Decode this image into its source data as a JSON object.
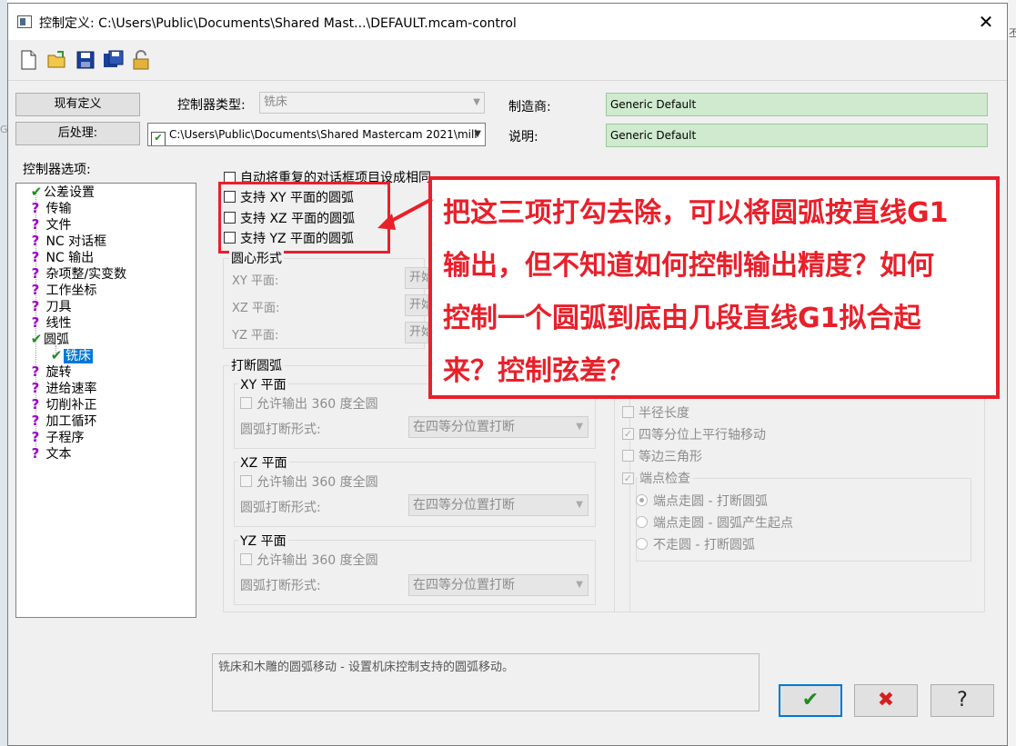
{
  "window": {
    "title": "控制定义: C:\\Users\\Public\\Documents\\Shared Mast...\\DEFAULT.mcam-control",
    "close": "✕"
  },
  "toolbar": {
    "icons": [
      "new-file-icon",
      "open-folder-icon",
      "save-icon",
      "save-as-icon",
      "lock-icon"
    ]
  },
  "buttons": {
    "current_def": "现有定义",
    "post": "后处理:"
  },
  "controller_type": {
    "label": "控制器类型:",
    "value": "铣床"
  },
  "post_path": "C:\\Users\\Public\\Documents\\Shared Mastercam 2021\\mill",
  "manufacturer": {
    "label": "制造商:",
    "value": "Generic Default"
  },
  "description": {
    "label": "说明:",
    "value": "Generic Default"
  },
  "tree": {
    "title": "控制器选项:",
    "items": [
      "公差设置",
      "传输",
      "文件",
      "NC 对话框",
      "NC 输出",
      "杂项整/实变数",
      "工作坐标",
      "刀具",
      "线性",
      "圆弧",
      "铣床",
      "旋转",
      "进给速率",
      "切削补正",
      "加工循环",
      "子程序",
      "文本"
    ]
  },
  "options": {
    "auto_set": "自动将重复的对话框项目设成相同",
    "support_xy": "支持 XY 平面的圆弧",
    "support_xz": "支持 XZ 平面的圆弧",
    "support_yz": "支持 YZ 平面的圆弧"
  },
  "center_form": {
    "title": "圆心形式",
    "rows": [
      {
        "label": "XY 平面:",
        "value": "开始"
      },
      {
        "label": "XZ 平面:",
        "value": "开始"
      },
      {
        "label": "YZ 平面:",
        "value": "开始"
      }
    ]
  },
  "break_arc": {
    "title": "打断圆弧",
    "planes": [
      {
        "title": "XY 平面",
        "allow": "允许输出 360 度全圆",
        "form_label": "圆弧打断形式:",
        "form_value": "在四等分位置打断"
      },
      {
        "title": "XZ 平面",
        "allow": "允许输出 360 度全圆",
        "form_label": "圆弧打断形式:",
        "form_value": "在四等分位置打断"
      },
      {
        "title": "YZ 平面",
        "allow": "允许输出 360 度全圆",
        "form_label": "圆弧打断形式:",
        "form_value": "在四等分位置打断"
      }
    ]
  },
  "right_panel": {
    "radius_length": "半径长度",
    "quadrant_parallel": "四等分位上平行轴移动",
    "equilateral": "等边三角形",
    "endpoint_check": "端点检查",
    "radios": [
      "端点走圆 - 打断圆弧",
      "端点走圆 - 圆弧产生起点",
      "不走圆 - 打断圆弧"
    ]
  },
  "status_text": "铣床和木雕的圆弧移动 - 设置机床控制支持的圆弧移动。",
  "dialog_buttons": {
    "ok": "✔",
    "cancel": "✖",
    "help": "?"
  },
  "annotation": {
    "lines": [
      "把这三项打勾去除，可以将圆弧按直线G1",
      "输出，但不知道如何控制输出精度？如何",
      "控制一个圆弧到底由几段直线G1拟合起",
      "来？控制弦差？"
    ]
  },
  "background_fragments": {
    "right_top": "丕",
    "right_mid": "G"
  },
  "colors": {
    "accent": "#e8202a",
    "selection": "#0078d7",
    "green_field": "#cfeacf"
  }
}
